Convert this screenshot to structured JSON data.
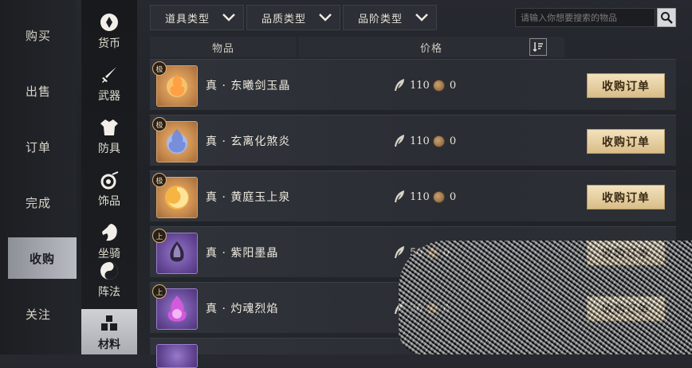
{
  "left_nav": [
    {
      "label": "购买",
      "active": false
    },
    {
      "label": "出售",
      "active": false
    },
    {
      "label": "订单",
      "active": false
    },
    {
      "label": "完成",
      "active": false
    },
    {
      "label": "收购",
      "active": true
    },
    {
      "label": "关注",
      "active": false
    }
  ],
  "categories": [
    {
      "label": "货币",
      "icon": "currency-icon"
    },
    {
      "label": "武器",
      "icon": "sword-icon"
    },
    {
      "label": "防具",
      "icon": "armor-icon"
    },
    {
      "label": "饰品",
      "icon": "accessory-icon"
    },
    {
      "label": "坐骑",
      "icon": "horse-icon"
    },
    {
      "label": "阵法",
      "icon": "yin-yang-icon"
    },
    {
      "label": "材料",
      "icon": "material-icon",
      "active": true
    }
  ],
  "filters": [
    {
      "label": "道具类型"
    },
    {
      "label": "品质类型"
    },
    {
      "label": "品阶类型"
    }
  ],
  "search": {
    "placeholder": "请输入你想要搜索的物品"
  },
  "table": {
    "col_item": "物品",
    "col_price": "价格"
  },
  "rows": [
    {
      "name": "真 · 东曦剑玉晶",
      "grade": "极",
      "price_feather": "110",
      "price_coin": "0",
      "button": "收购订单",
      "thumb_color": "#e9a45a"
    },
    {
      "name": "真 · 玄离化煞炎",
      "grade": "极",
      "price_feather": "110",
      "price_coin": "0",
      "button": "收购订单",
      "thumb_color": "#8fa7e6"
    },
    {
      "name": "真 · 黄庭玉上泉",
      "grade": "极",
      "price_feather": "110",
      "price_coin": "0",
      "button": "收购订单",
      "thumb_color": "#f0b24a"
    },
    {
      "name": "真 · 紫阳墨晶",
      "grade": "上",
      "price_feather": "56",
      "price_coin": "0",
      "button": "收购订单",
      "thumb_color": "#9c7bd6"
    },
    {
      "name": "真 · 灼魂烈焰",
      "grade": "上",
      "price_feather": "56",
      "price_coin": "0",
      "button": "收购订单",
      "thumb_color": "#c45ad0"
    }
  ],
  "colors": {
    "accent_button": "#e9d3a6",
    "active_nav": "#b8bbc1"
  }
}
